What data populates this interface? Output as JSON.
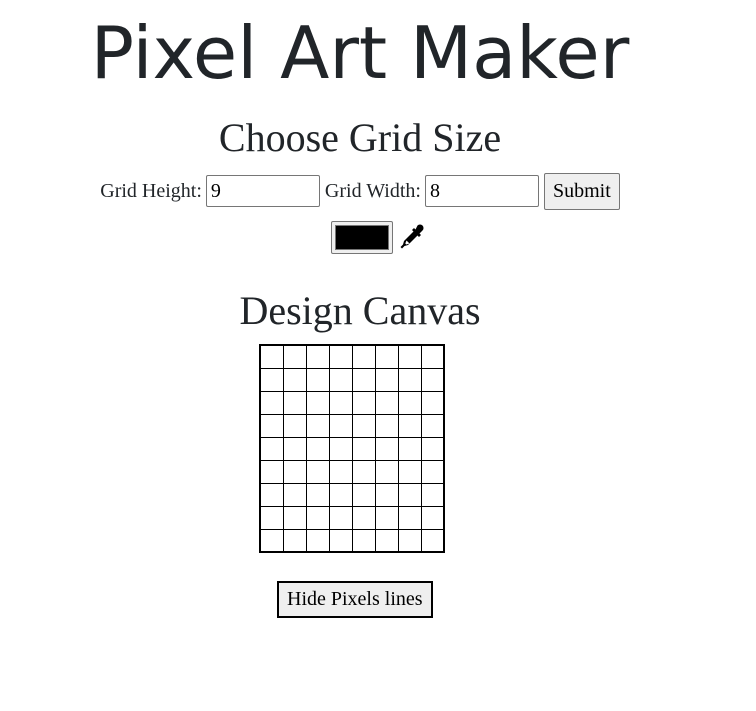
{
  "page": {
    "title": "Pixel Art Maker"
  },
  "grid_size": {
    "heading": "Choose Grid Size",
    "height_label": "Grid Height:",
    "height_value": "9",
    "width_label": "Grid Width:",
    "width_value": "8",
    "submit_label": "Submit"
  },
  "color_picker": {
    "value": "#000000",
    "icon": "eyedropper-icon"
  },
  "canvas": {
    "heading": "Design Canvas",
    "rows": 9,
    "columns": 8,
    "toggle_lines_label": "Hide Pixels lines"
  }
}
